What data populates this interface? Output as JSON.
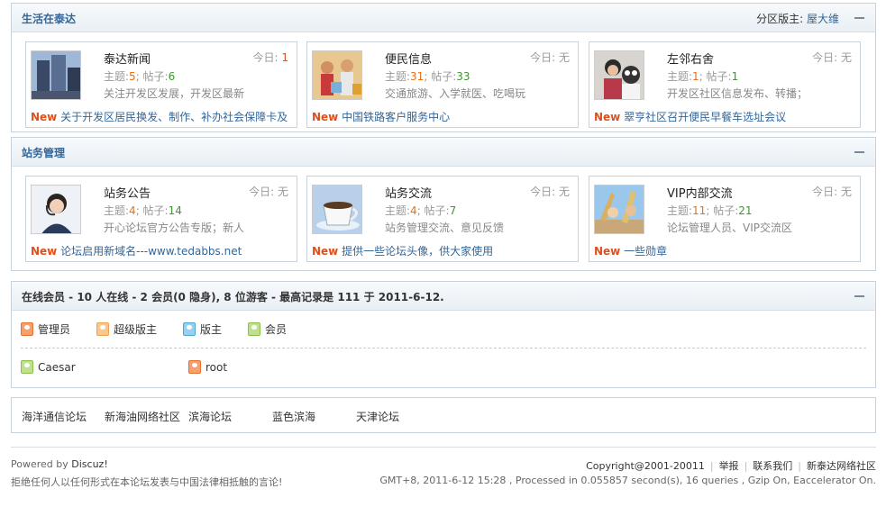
{
  "sections": [
    {
      "title": "生活在泰达",
      "moderator_label": "分区版主:",
      "moderator": "屋大维",
      "boards": [
        {
          "name": "泰达新闻",
          "today_label": "今日:",
          "today": "1",
          "topics_label": "主题:",
          "topics": "5",
          "posts_label": "帖子:",
          "posts": "6",
          "desc": "关注开发区发展，开发区最新",
          "new_label": "New",
          "latest": "关于开发区居民换发、制作、补办社会保障卡及"
        },
        {
          "name": "便民信息",
          "today_label": "今日:",
          "today": "无",
          "topics_label": "主题:",
          "topics": "31",
          "posts_label": "帖子:",
          "posts": "33",
          "desc": "交通旅游、入学就医、吃喝玩",
          "new_label": "New",
          "latest": "中国铁路客户服务中心"
        },
        {
          "name": "左邻右舍",
          "today_label": "今日:",
          "today": "无",
          "topics_label": "主题:",
          "topics": "1",
          "posts_label": "帖子:",
          "posts": "1",
          "desc": "开发区社区信息发布、转播；",
          "new_label": "New",
          "latest": "翠亨社区召开便民早餐车选址会议"
        }
      ]
    },
    {
      "title": "站务管理",
      "boards": [
        {
          "name": "站务公告",
          "today_label": "今日:",
          "today": "无",
          "topics_label": "主题:",
          "topics": "4",
          "posts_label": "帖子:",
          "posts": "14",
          "desc": "开心论坛官方公告专版；新人",
          "new_label": "New",
          "latest": "论坛启用新域名---www.tedabbs.net"
        },
        {
          "name": "站务交流",
          "today_label": "今日:",
          "today": "无",
          "topics_label": "主题:",
          "topics": "4",
          "posts_label": "帖子:",
          "posts": "7",
          "desc": "站务管理交流、意见反馈",
          "new_label": "New",
          "latest": "提供一些论坛头像，供大家使用"
        },
        {
          "name": "VIP内部交流",
          "today_label": "今日:",
          "today": "无",
          "topics_label": "主题:",
          "topics": "11",
          "posts_label": "帖子:",
          "posts": "21",
          "desc": "论坛管理人员、VIP交流区",
          "new_label": "New",
          "latest": "一些勋章"
        }
      ]
    }
  ],
  "online": {
    "title": "在线会员 - 10 人在线 - 2 会员(0 隐身), 8 位游客 - 最高记录是 111 于 2011-6-12.",
    "legend": [
      {
        "label": "管理员",
        "color": "#e8702a"
      },
      {
        "label": "超级版主",
        "color": "#f0a04a"
      },
      {
        "label": "版主",
        "color": "#4aa8d8"
      },
      {
        "label": "会员",
        "color": "#8ac048"
      }
    ],
    "users": [
      {
        "name": "Caesar",
        "color": "#8ac048"
      },
      {
        "name": "root",
        "color": "#e8702a"
      }
    ]
  },
  "friend_links": [
    "海洋通信论坛",
    "新海油网络社区",
    "滨海论坛",
    "蓝色滨海",
    "天津论坛"
  ],
  "footer": {
    "powered_prefix": "Powered by",
    "powered_name": "Discuz!",
    "disclaimer": "拒绝任何人以任何形式在本论坛发表与中国法律相抵触的言论!",
    "copyright": "Copyright@2001-20011",
    "links": [
      "举报",
      "联系我们",
      "新泰达网络社区"
    ],
    "stats": "GMT+8, 2011-6-12 15:28 , Processed in 0.055857 second(s), 16 queries , Gzip On, Eaccelerator On."
  }
}
